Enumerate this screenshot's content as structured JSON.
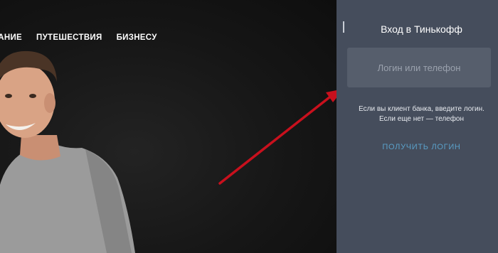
{
  "nav": {
    "items": [
      "ОВАНИЕ",
      "ПУТЕШЕСТВИЯ",
      "БИЗНЕСУ"
    ]
  },
  "login": {
    "title": "Вход в Тинькофф",
    "field_placeholder": "Логин или телефон",
    "hint_line1": "Если вы клиент банка, введите логин.",
    "hint_line2": "Если еще нет — телефон",
    "get_login": "ПОЛУЧИТЬ ЛОГИН"
  },
  "colors": {
    "panel_bg": "#454d5c",
    "link": "#5aa0c9",
    "arrow": "#c8101d"
  }
}
